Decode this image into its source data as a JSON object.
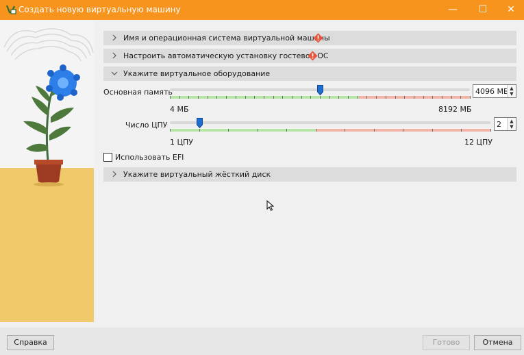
{
  "window": {
    "title": "Создать новую виртуальную машину",
    "min_glyph": "—",
    "max_glyph": "☐",
    "close_glyph": "✕",
    "accent_color": "#f7941d"
  },
  "sections": {
    "name_os": {
      "label": "Имя и операционная система виртуальной машины",
      "expanded": false,
      "warning": true
    },
    "unattended": {
      "label": "Настроить автоматическую установку гостевой ОС",
      "expanded": false,
      "warning": true
    },
    "hardware": {
      "label": "Укажите виртуальное оборудование",
      "expanded": true,
      "warning": false
    },
    "disk": {
      "label": "Укажите виртуальный жёсткий диск",
      "expanded": false,
      "warning": false
    }
  },
  "hardware": {
    "memory": {
      "label": "Основная память",
      "value": "4096 МБ",
      "min_label": "4 МБ",
      "max_label": "8192 МБ",
      "min": 4,
      "max": 8192,
      "current": 4096
    },
    "cpu": {
      "label": "Число ЦПУ",
      "value": "2",
      "min_label": "1 ЦПУ",
      "max_label": "12 ЦПУ",
      "min": 1,
      "max": 12,
      "current": 2
    },
    "efi": {
      "label": "Использовать EFI",
      "checked": false
    }
  },
  "buttons": {
    "help": "Справка",
    "finish": "Готово",
    "cancel": "Отмена"
  },
  "icons": {
    "app": "virtualbox-icon",
    "warning": "warning-icon",
    "chevron": "chevron-icon"
  },
  "colors": {
    "safe_range": "#b8e6a8",
    "unsafe_range": "#f2b6a8",
    "thumb": "#1f6fd1",
    "warning": "#e8553a"
  }
}
